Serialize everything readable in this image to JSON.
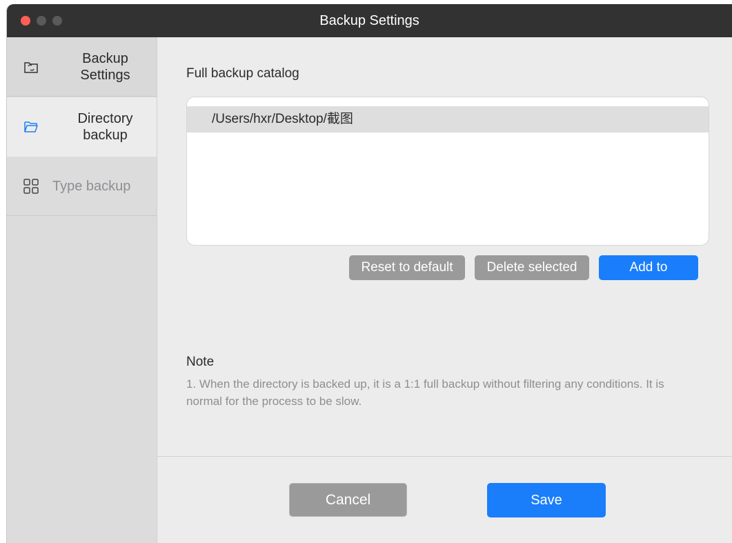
{
  "window": {
    "title": "Backup Settings"
  },
  "sidebar": {
    "items": [
      {
        "label": "Backup Settings",
        "icon": "backup-folder-icon"
      },
      {
        "label": "Directory backup",
        "icon": "folder-open-icon"
      },
      {
        "label": "Type backup",
        "icon": "grid-icon"
      }
    ]
  },
  "main": {
    "section_title": "Full backup catalog",
    "directories": [
      "/Users/hxr/Desktop/截图"
    ],
    "buttons": {
      "reset": "Reset to default",
      "delete": "Delete selected",
      "add": "Add to"
    },
    "note": {
      "title": "Note",
      "text": "1. When the directory is backed up, it is a 1:1 full backup without filtering any conditions. It is normal for the process to be slow."
    }
  },
  "footer": {
    "cancel": "Cancel",
    "save": "Save"
  },
  "colors": {
    "accent": "#1a7efb",
    "titlebar": "#323232",
    "close": "#ff5f57"
  }
}
